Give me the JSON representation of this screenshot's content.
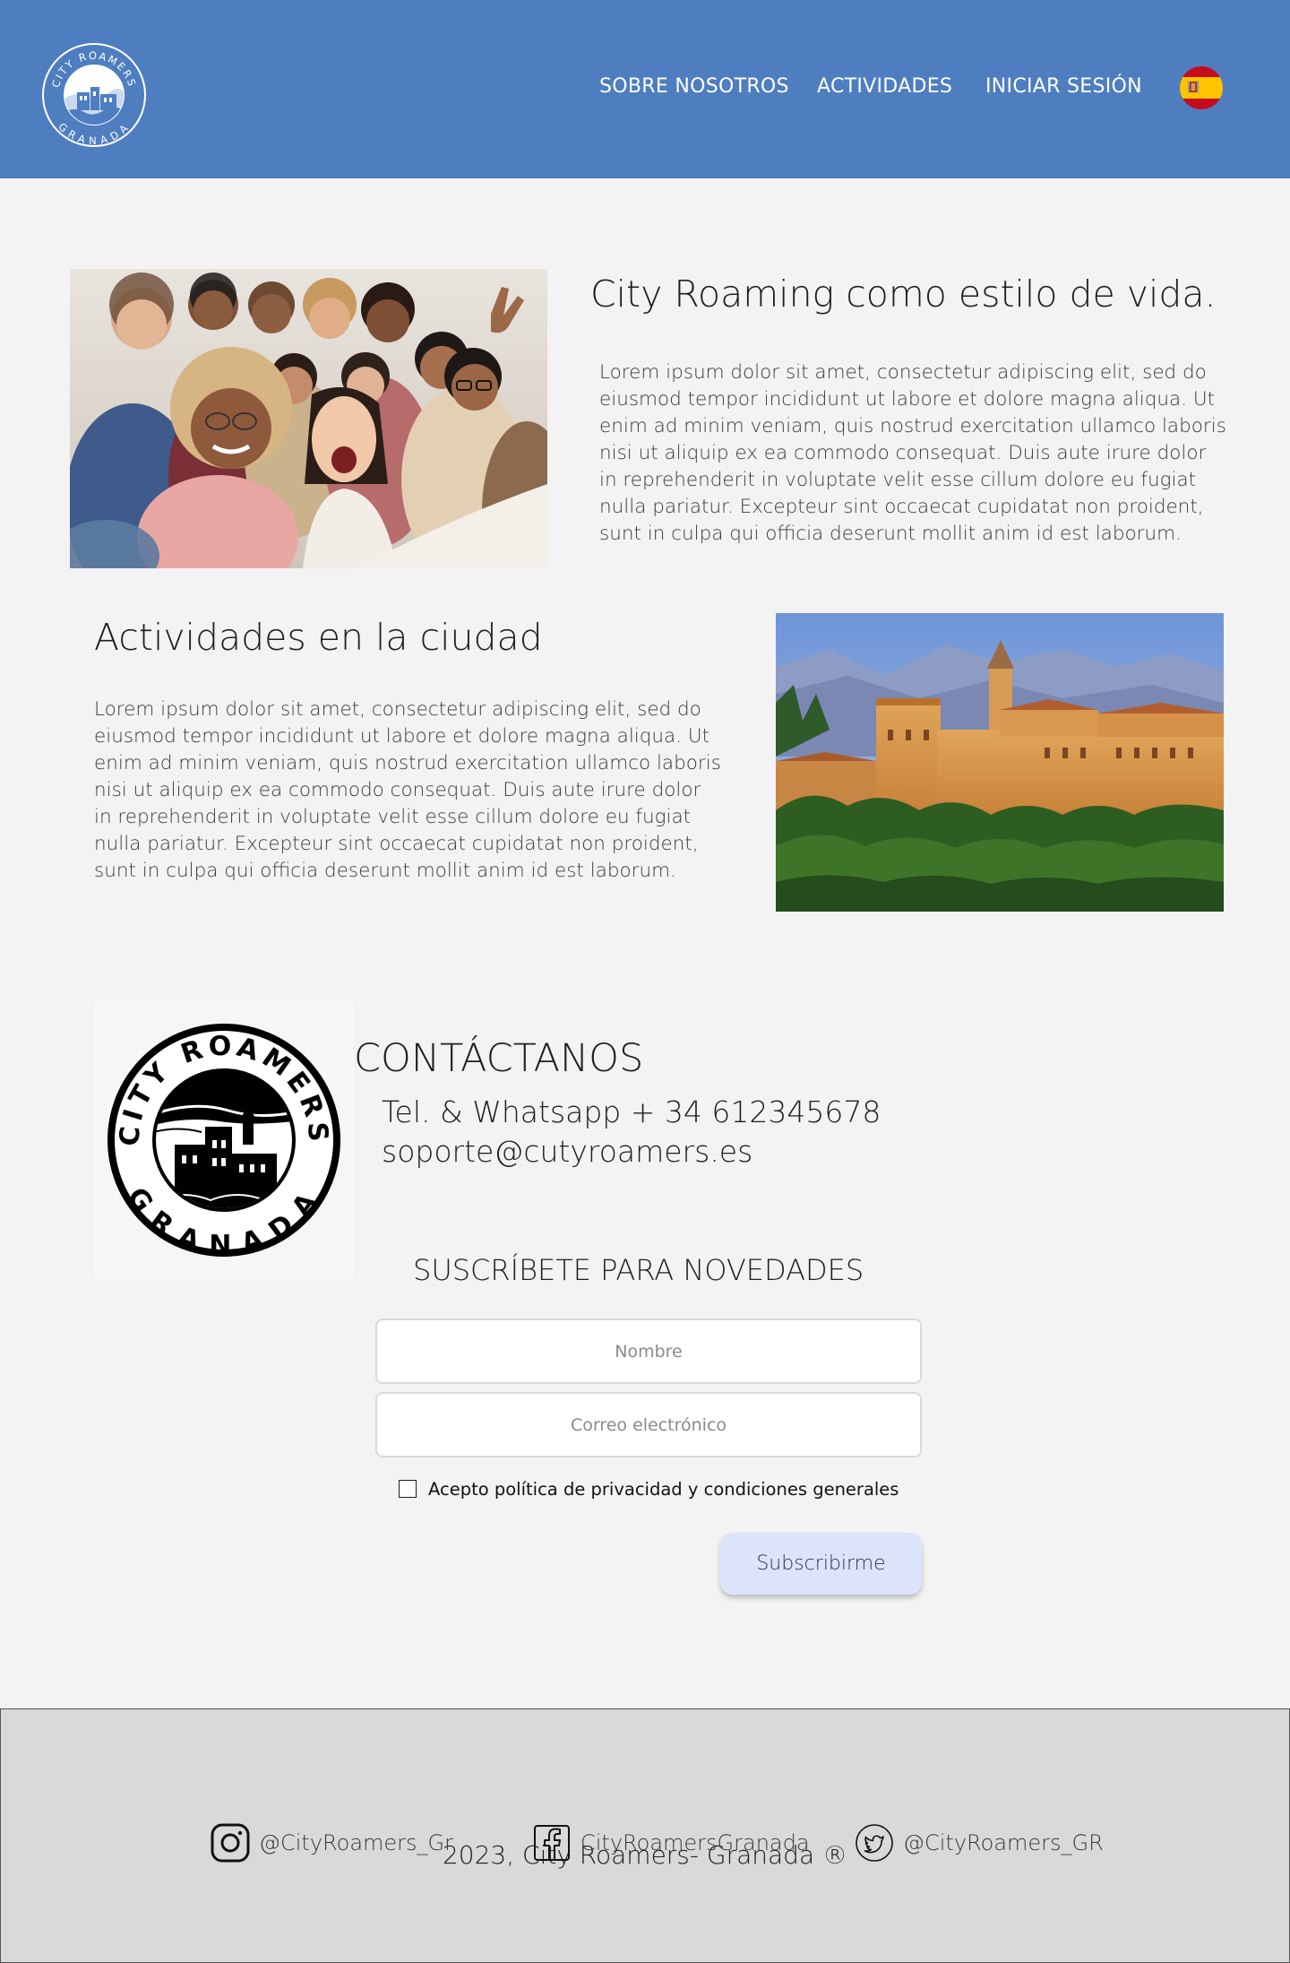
{
  "header": {
    "logo": {
      "top_text": "CITY ROAMERS",
      "bottom_text": "GRANADA"
    },
    "nav": [
      {
        "label": "SOBRE NOSOTROS"
      },
      {
        "label": "ACTIVIDADES"
      },
      {
        "label": "INICIAR SESIÓN"
      }
    ],
    "language_icon": "spain-flag-icon",
    "background_color": "#4e7ec0"
  },
  "intro": {
    "title": "City Roaming como estilo de vida.",
    "body": "Lorem ipsum dolor sit amet, consectetur adipiscing elit, sed do eiusmod tempor incididunt ut labore et dolore magna aliqua. Ut enim ad minim veniam, quis nostrud exercitation ullamco laboris nisi ut aliquip ex ea commodo consequat. Duis aute irure dolor in reprehenderit in voluptate velit esse cillum dolore eu fugiat nulla pariatur. Excepteur sint occaecat cupidatat non proident, sunt in culpa qui officia deserunt mollit anim id est laborum.",
    "image": "group-selfie-photo"
  },
  "activities": {
    "title": "Actividades en la ciudad",
    "body": "Lorem ipsum dolor sit amet, consectetur adipiscing elit, sed do eiusmod tempor incididunt ut labore et dolore magna aliqua. Ut enim ad minim veniam, quis nostrud exercitation ullamco laboris nisi ut aliquip ex ea commodo consequat. Duis aute irure dolor in reprehenderit in voluptate velit esse cillum dolore eu fugiat nulla pariatur. Excepteur sint occaecat cupidatat non proident, sunt in culpa qui officia deserunt mollit anim id est laborum.",
    "image": "alhambra-photo"
  },
  "contact": {
    "badge": {
      "top_text": "CITY ROAMERS",
      "bottom_text": "GRANADA"
    },
    "title": "CONTÁCTANOS",
    "phone": "Tel. & Whatsapp + 34 612345678",
    "email": "soporte@cutyroamers.es"
  },
  "subscribe": {
    "title": "SUSCRÍBETE PARA NOVEDADES",
    "name_placeholder": "Nombre",
    "email_placeholder": "Correo electrónico",
    "consent_label": "Acepto política de privacidad y condiciones generales",
    "button_label": "Subscribirme",
    "button_color": "#dce4fa"
  },
  "footer": {
    "copyright": "2023, City Roamers- Granada ®",
    "social": [
      {
        "icon": "instagram-icon",
        "label": "@CityRoamers_Gr"
      },
      {
        "icon": "facebook-icon",
        "label": "CityRoamersGranada"
      },
      {
        "icon": "twitter-icon",
        "label": "@CityRoamers_GR"
      }
    ],
    "background_color": "#d9d9d9"
  }
}
